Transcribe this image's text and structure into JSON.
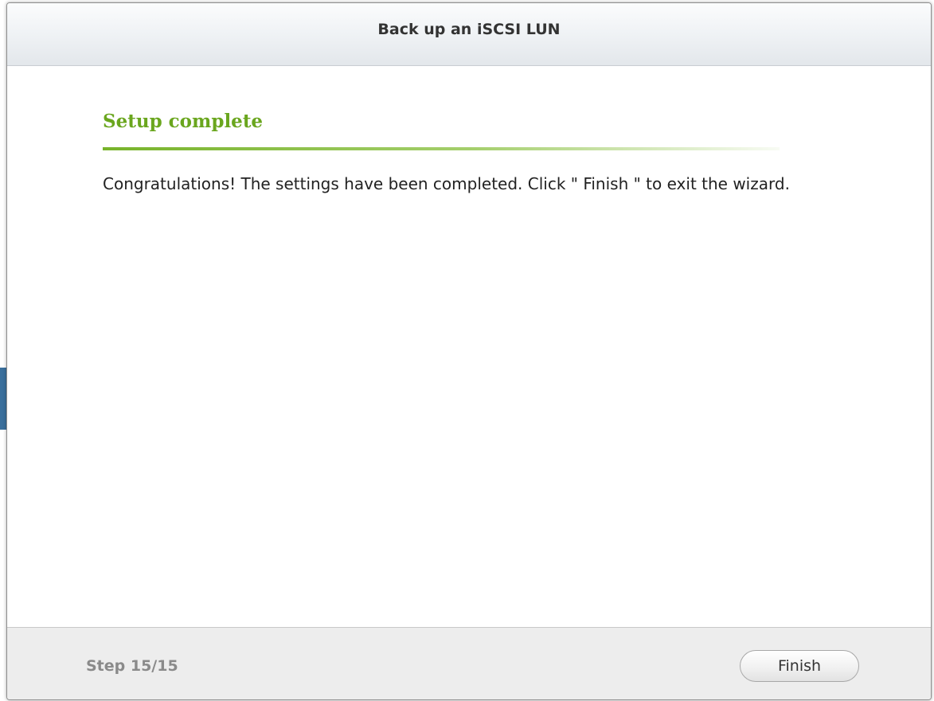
{
  "dialog": {
    "title": "Back up an iSCSI LUN"
  },
  "section": {
    "heading": "Setup complete",
    "message": "Congratulations! The settings have been completed. Click \" Finish \" to exit the wizard."
  },
  "footer": {
    "step_label": "Step 15/15",
    "finish_label": "Finish"
  },
  "colors": {
    "accent_green": "#6aa61e",
    "step_text": "#8a8a8a"
  }
}
